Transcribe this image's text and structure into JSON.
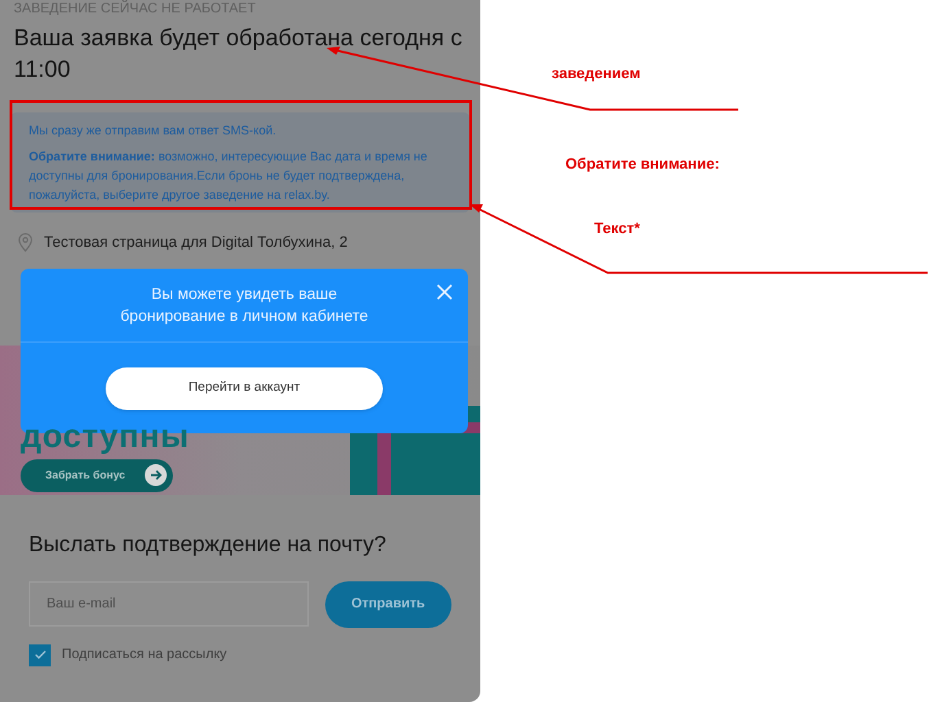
{
  "status_label": "ЗАВЕДЕНИЕ СЕЙЧАС НЕ РАБОТАЕТ",
  "title": "Ваша заявка будет обработана сегодня с 11:00",
  "notice": {
    "line1": "Мы сразу же отправим вам ответ SMS-кой.",
    "line2": "**Обратите внимание:** возможно, интересующие Вас дата и время не доступны для бронирования.Если бронь не будет подтверждена, пожалуйста, выберите другое заведение на relax.by."
  },
  "address": "Тестовая страница для Digital Толбухина, 2",
  "banner": {
    "headline": "доступны",
    "button": "Забрать бонус"
  },
  "email_form": {
    "title": "Выслать подтверждение на почту?",
    "placeholder": "Ваш e-mail",
    "button": "Отправить",
    "subscribe": {
      "label": "Подписаться на рассылку",
      "checked": true
    }
  },
  "modal": {
    "message": "Вы можете увидеть ваше бронирование в личном кабинете",
    "button": "Перейти в аккаунт"
  },
  "annotations": [
    {
      "text": "заведением"
    },
    {
      "text": "Обратите внимание:"
    },
    {
      "text": "Текст*"
    }
  ]
}
